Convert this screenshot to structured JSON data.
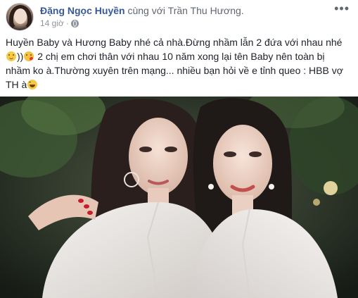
{
  "post": {
    "author": "Đặng Ngọc Huyền",
    "with_text": " cùng với ",
    "tagged_person": "Trần Thu Hương.",
    "timestamp": "14 giờ",
    "separator": "·",
    "privacy_icon": "globe-icon",
    "more_icon": "more-horizontal-icon",
    "text_part1": "Huyền Baby và Hương Baby nhé cả nhà.Đừng nhầm lẫn 2 đứa với nhau nhé ",
    "text_part2": "))",
    "text_part3": " 2 chị em chơi thân với nhau 10 năm xong lại tên Baby nên toàn bị nhầm ko à.Thường xuyên trên mạng... nhiều bạn hỏi về e tỉnh queo : HBB vợ TH à",
    "emojis": [
      "slightly-smiling-face",
      "face-blowing-kiss",
      "grinning-squinting-face"
    ]
  },
  "colors": {
    "author": "#385898",
    "secondary_text": "#606770",
    "body_text": "#1d2129",
    "meta_text": "#90949c"
  }
}
